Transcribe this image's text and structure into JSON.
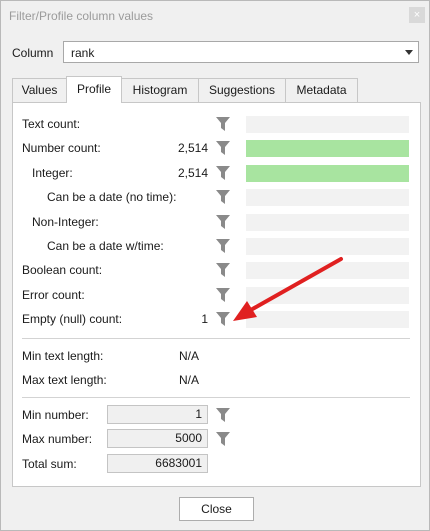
{
  "window": {
    "title": "Filter/Profile column values",
    "close_glyph": "×"
  },
  "column": {
    "label": "Column",
    "value": "rank"
  },
  "tabs": [
    {
      "label": "Values",
      "active": false
    },
    {
      "label": "Profile",
      "active": true
    },
    {
      "label": "Histogram",
      "active": false
    },
    {
      "label": "Suggestions",
      "active": false
    },
    {
      "label": "Metadata",
      "active": false
    }
  ],
  "profile": {
    "rows": [
      {
        "label": "Text count:",
        "value": "",
        "fill": 0
      },
      {
        "label": "Number count:",
        "value": "2,514",
        "fill": 1.0
      },
      {
        "label": "Integer:",
        "value": "2,514",
        "fill": 1.0
      },
      {
        "label": "Can be a date (no time):",
        "value": "",
        "fill": 0
      },
      {
        "label": "Non-Integer:",
        "value": "",
        "fill": 0
      },
      {
        "label": "Can be a date w/time:",
        "value": "",
        "fill": 0
      },
      {
        "label": "Boolean count:",
        "value": "",
        "fill": 0
      },
      {
        "label": "Error count:",
        "value": "",
        "fill": 0
      },
      {
        "label": "Empty (null) count:",
        "value": "1",
        "fill": 0.0004
      }
    ],
    "min_text_length": {
      "label": "Min text length:",
      "value": "N/A"
    },
    "max_text_length": {
      "label": "Max text length:",
      "value": "N/A"
    },
    "min_number": {
      "label": "Min number:",
      "value": "1"
    },
    "max_number": {
      "label": "Max number:",
      "value": "5000"
    },
    "total_sum": {
      "label": "Total sum:",
      "value": "6683001"
    }
  },
  "buttons": {
    "close": "Close"
  },
  "colors": {
    "bar_fill": "#a8e4a0",
    "arrow": "#e02020",
    "filter_icon": "#8a8a8a"
  }
}
